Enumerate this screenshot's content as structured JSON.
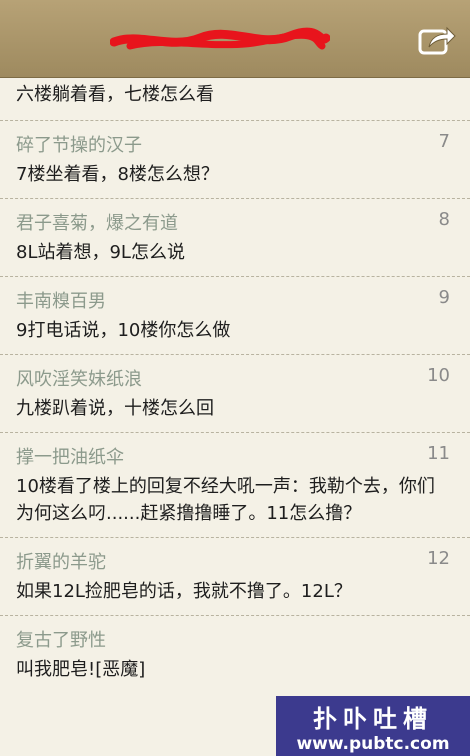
{
  "header": {
    "title_redacted": true,
    "share_icon": "share-arrow-icon"
  },
  "first_post": {
    "content": "六楼躺着看，七楼怎么看"
  },
  "posts": [
    {
      "user": "碎了节操的汉子",
      "floor": "7",
      "content": "7楼坐着看，8楼怎么想？"
    },
    {
      "user": "君子喜菊，爆之有道",
      "floor": "8",
      "content": "8L站着想，9L怎么说"
    },
    {
      "user": "丰南糗百男",
      "floor": "9",
      "content": "9打电话说，10楼你怎么做"
    },
    {
      "user": "风吹淫笑妹纸浪",
      "floor": "10",
      "content": "九楼趴着说，十楼怎么回"
    },
    {
      "user": "撑一把油纸伞",
      "floor": "11",
      "content": "10楼看了楼上的回复不经大吼一声：我勒个去，你们为何这么叼......赶紧撸撸睡了。11怎么撸？"
    },
    {
      "user": "折翼的羊驼",
      "floor": "12",
      "content": "如果12L捡肥皂的话，我就不撸了。12L？"
    },
    {
      "user": "复古了野性",
      "floor": "",
      "content": "叫我肥皂![恶魔]"
    }
  ],
  "watermark": {
    "line1": "扑卟吐槽",
    "line2": "www.pubtc.com"
  },
  "colors": {
    "header": "#a8946a",
    "background": "#f4f1e6",
    "username": "#8c9a8c",
    "watermark_bg": "#3c3a8e"
  }
}
